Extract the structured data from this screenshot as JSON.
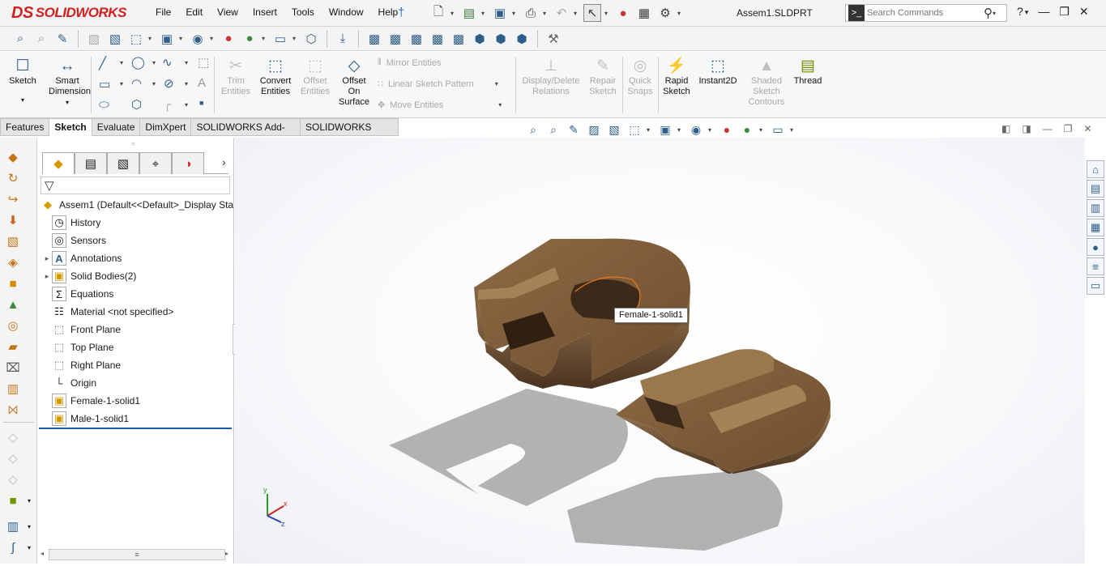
{
  "app": {
    "brand": "SOLIDWORKS",
    "brand_glyph": "DS",
    "document_title": "Assem1.SLDPRT"
  },
  "menu": [
    "File",
    "Edit",
    "View",
    "Insert",
    "Tools",
    "Window",
    "Help"
  ],
  "search": {
    "placeholder": "Search Commands"
  },
  "command_manager": {
    "sketch": "Sketch",
    "smart_dimension": [
      "Smart",
      "Dimension"
    ],
    "trim_entities": [
      "Trim",
      "Entities"
    ],
    "convert_entities": [
      "Convert",
      "Entities"
    ],
    "offset_entities": [
      "Offset",
      "Entities"
    ],
    "offset_on_surface": [
      "Offset",
      "On",
      "Surface"
    ],
    "mirror_entities": "Mirror Entities",
    "linear_sketch_pattern": "Linear Sketch Pattern",
    "move_entities": "Move Entities",
    "display_delete_relations": [
      "Display/Delete",
      "Relations"
    ],
    "repair_sketch": [
      "Repair",
      "Sketch"
    ],
    "quick_snaps": [
      "Quick",
      "Snaps"
    ],
    "rapid_sketch": [
      "Rapid",
      "Sketch"
    ],
    "instant2d": "Instant2D",
    "shaded_sketch_contours": [
      "Shaded",
      "Sketch",
      "Contours"
    ],
    "thread": "Thread"
  },
  "tabs": [
    {
      "label": "Features",
      "active": false
    },
    {
      "label": "Sketch",
      "active": true
    },
    {
      "label": "Evaluate",
      "active": false
    },
    {
      "label": "DimXpert",
      "active": false
    },
    {
      "label": "SOLIDWORKS Add-Ins",
      "active": false
    },
    {
      "label": "SOLIDWORKS MBD",
      "active": false
    }
  ],
  "feature_tree": {
    "root": "Assem1  (Default<<Default>_Display Sta",
    "items": [
      {
        "label": "History",
        "icon": "history-icon",
        "expandable": false
      },
      {
        "label": "Sensors",
        "icon": "sensors-icon",
        "expandable": false
      },
      {
        "label": "Annotations",
        "icon": "annotations-icon",
        "expandable": true
      },
      {
        "label": "Solid Bodies(2)",
        "icon": "solid-bodies-icon",
        "expandable": true
      },
      {
        "label": "Equations",
        "icon": "equations-icon",
        "expandable": false
      },
      {
        "label": "Material <not specified>",
        "icon": "material-icon",
        "expandable": false
      },
      {
        "label": "Front Plane",
        "icon": "plane-icon",
        "expandable": false
      },
      {
        "label": "Top Plane",
        "icon": "plane-icon",
        "expandable": false
      },
      {
        "label": "Right Plane",
        "icon": "plane-icon",
        "expandable": false
      },
      {
        "label": "Origin",
        "icon": "origin-icon",
        "expandable": false
      },
      {
        "label": "Female-1-solid1",
        "icon": "part-body-icon",
        "expandable": false
      },
      {
        "label": "Male-1-solid1",
        "icon": "part-body-icon",
        "expandable": false
      }
    ]
  },
  "graphics": {
    "hover_tooltip": "Female-1-solid1",
    "triad": {
      "x": "x",
      "y": "y",
      "z": "z"
    }
  },
  "colors": {
    "brand_red": "#d0201f",
    "accent_blue": "#2d5d8a",
    "wood": "#7a5532"
  }
}
